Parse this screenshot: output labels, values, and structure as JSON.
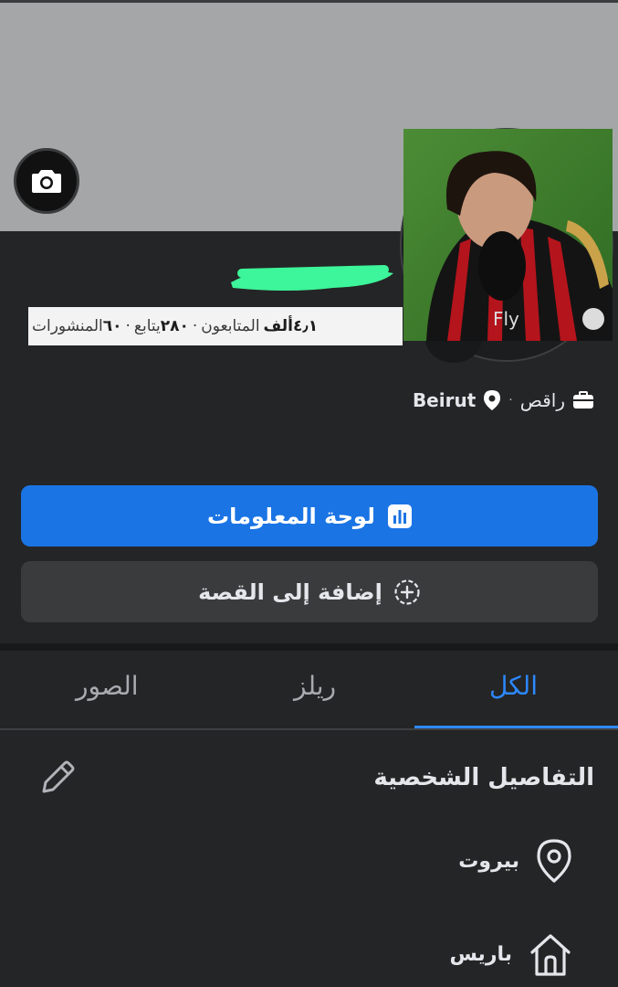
{
  "profile": {
    "stats": {
      "followers_count": "٤٫١",
      "followers_unit": "ألف",
      "followers_label": "المتابعون",
      "following_count": "٢٨٠",
      "following_label": "يتابع",
      "posts_count": "٦٠",
      "posts_label": "المنشورات",
      "separator": "·"
    },
    "job": "راقص",
    "location": "Beirut"
  },
  "actions": {
    "dashboard_label": "لوحة المعلومات",
    "add_story_label": "إضافة إلى القصة"
  },
  "tabs": [
    {
      "label": "الكل",
      "active": true
    },
    {
      "label": "ريلز",
      "active": false
    },
    {
      "label": "الصور",
      "active": false
    }
  ],
  "details": {
    "title": "التفاصيل الشخصية",
    "current_city": "بيروت",
    "hometown": "باريس"
  },
  "colors": {
    "accent": "#1b74e4",
    "tab_active": "#2d88ff",
    "background": "#242526",
    "cover": "#a5a6a8",
    "name_redaction": "#3df59a"
  },
  "icons": [
    "camera-icon",
    "chart-icon",
    "add-circle-icon",
    "location-pin-icon",
    "briefcase-icon",
    "edit-pencil-icon",
    "map-pin-icon",
    "home-icon"
  ]
}
